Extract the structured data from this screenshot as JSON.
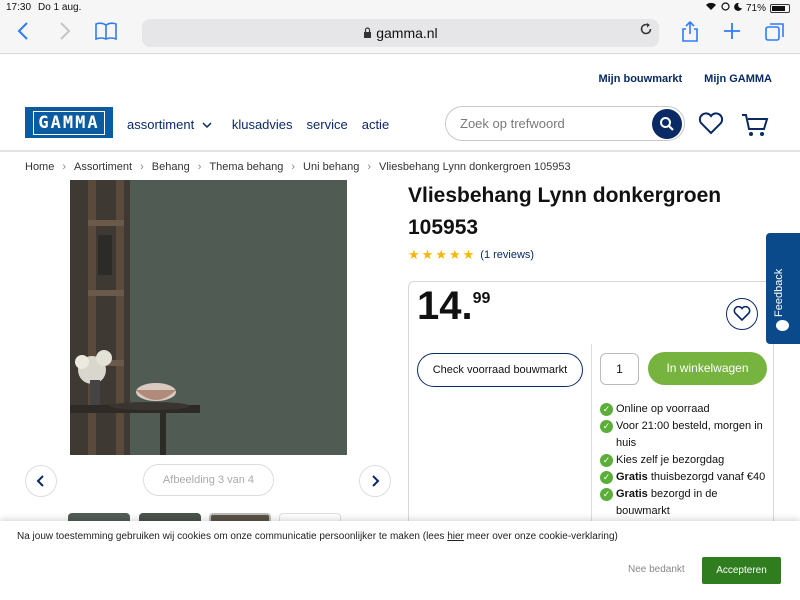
{
  "statusbar": {
    "time": "17:30",
    "date": "Do 1 aug.",
    "battery": "71%"
  },
  "browser": {
    "url": "gamma.nl"
  },
  "header": {
    "toplinks": [
      "Mijn bouwmarkt",
      "Mijn GAMMA"
    ],
    "logo": "GAMMA",
    "nav": {
      "assortiment": "assortiment",
      "klusadvies": "klusadvies",
      "service": "service",
      "actie": "actie"
    },
    "search_placeholder": "Zoek op trefwoord"
  },
  "breadcrumb": [
    "Home",
    "Assortiment",
    "Behang",
    "Thema behang",
    "Uni behang",
    "Vliesbehang Lynn donkergroen 105953"
  ],
  "gallery": {
    "counter": "Afbeelding 3 van 4"
  },
  "product": {
    "title": "Vliesbehang Lynn donkergroen 105953",
    "rating": 5,
    "reviews": "(1 reviews)",
    "price_whole": "14.",
    "price_cents": "99",
    "stock_button": "Check voorraad bouwmarkt",
    "quantity": "1",
    "cart_button": "In winkelwagen",
    "usps": [
      {
        "bold": "",
        "text": "Online op voorraad"
      },
      {
        "bold": "",
        "text": "Voor 21:00 besteld, morgen in huis"
      },
      {
        "bold": "",
        "text": "Kies zelf je bezorgdag"
      },
      {
        "bold": "Gratis",
        "text": " thuisbezorgd vanaf €40"
      },
      {
        "bold": "Gratis",
        "text": " bezorgd in de bouwmarkt"
      }
    ]
  },
  "feedback": {
    "label": "Feedback"
  },
  "cookie": {
    "message_before": "Na jouw toestemming gebruiken wij cookies om onze communicatie persoonlijker te maken (lees ",
    "message_link": "hier",
    "message_after": " meer over onze cookie-verklaring)",
    "deny": "Nee bedankt",
    "accept": "Accepteren"
  },
  "colors": {
    "brand": "#0a5ba0",
    "navy": "#0a2a66",
    "cta": "#76b33f",
    "accept": "#2f7d1e"
  }
}
